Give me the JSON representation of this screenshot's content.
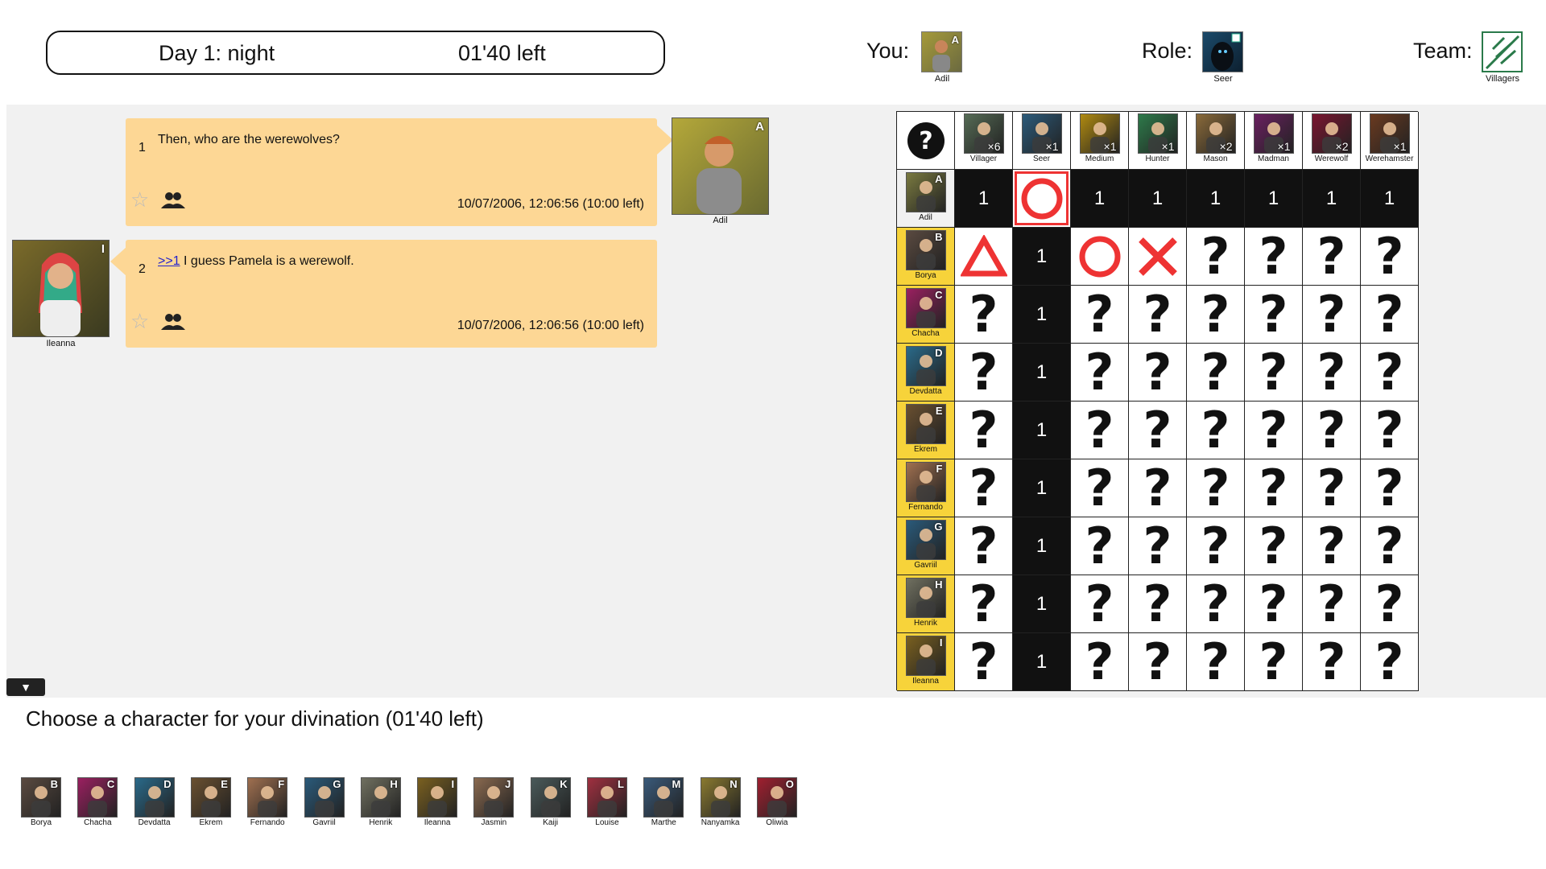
{
  "header": {
    "phase": "Day 1: night",
    "timer": "01'40 left",
    "you_label": "You:",
    "you_name": "Adil",
    "you_letter": "A",
    "role_label": "Role:",
    "role_name": "Seer",
    "team_label": "Team:",
    "team_name": "Villagers"
  },
  "messages": [
    {
      "num": "1",
      "text": "Then, who are the werewolves?",
      "timestamp": "10/07/2006, 12:06:56 (10:00 left)",
      "author": "Adil",
      "letter": "A"
    },
    {
      "num": "2",
      "reply": ">>1",
      "text": " I guess Pamela is a werewolf.",
      "timestamp": "10/07/2006, 12:06:56 (10:00 left)",
      "author": "Ileanna",
      "letter": "I"
    }
  ],
  "grid": {
    "unknown_icon": "question-circle-icon",
    "roles": [
      {
        "name": "Villager",
        "count": "×6",
        "color": "#556b55"
      },
      {
        "name": "Seer",
        "count": "×1",
        "color": "#2b5a7a"
      },
      {
        "name": "Medium",
        "count": "×1",
        "color": "#b08a10"
      },
      {
        "name": "Hunter",
        "count": "×1",
        "color": "#2d7a4a"
      },
      {
        "name": "Mason",
        "count": "×2",
        "color": "#8a6a3a"
      },
      {
        "name": "Madman",
        "count": "×1",
        "color": "#6a2060"
      },
      {
        "name": "Werewolf",
        "count": "×2",
        "color": "#7a1530"
      },
      {
        "name": "Werehamster",
        "count": "×1",
        "color": "#6a3a20"
      }
    ],
    "players": [
      {
        "name": "Adil",
        "letter": "A",
        "color": "#7a7a40",
        "cells": [
          "1",
          "sel",
          "1",
          "1",
          "1",
          "1",
          "1",
          "1"
        ]
      },
      {
        "name": "Borya",
        "letter": "B",
        "color": "#5a4a40",
        "cells": [
          "tri",
          "1",
          "circle",
          "cross",
          "?",
          "?",
          "?",
          "?"
        ]
      },
      {
        "name": "Chacha",
        "letter": "C",
        "color": "#9a2060",
        "cells": [
          "?",
          "1",
          "?",
          "?",
          "?",
          "?",
          "?",
          "?"
        ]
      },
      {
        "name": "Devdatta",
        "letter": "D",
        "color": "#2a6a8a",
        "cells": [
          "?",
          "1",
          "?",
          "?",
          "?",
          "?",
          "?",
          "?"
        ]
      },
      {
        "name": "Ekrem",
        "letter": "E",
        "color": "#6a5030",
        "cells": [
          "?",
          "1",
          "?",
          "?",
          "?",
          "?",
          "?",
          "?"
        ]
      },
      {
        "name": "Fernando",
        "letter": "F",
        "color": "#a07050",
        "cells": [
          "?",
          "1",
          "?",
          "?",
          "?",
          "?",
          "?",
          "?"
        ]
      },
      {
        "name": "Gavriil",
        "letter": "G",
        "color": "#2a5a7a",
        "cells": [
          "?",
          "1",
          "?",
          "?",
          "?",
          "?",
          "?",
          "?"
        ]
      },
      {
        "name": "Henrik",
        "letter": "H",
        "color": "#707060",
        "cells": [
          "?",
          "1",
          "?",
          "?",
          "?",
          "?",
          "?",
          "?"
        ]
      },
      {
        "name": "Ileanna",
        "letter": "I",
        "color": "#7a6020",
        "cells": [
          "?",
          "1",
          "?",
          "?",
          "?",
          "?",
          "?",
          "?"
        ]
      }
    ]
  },
  "choose": {
    "title": "Choose a character for your divination (01'40 left)",
    "collapse_icon": "chevron-down-icon",
    "characters": [
      {
        "name": "Borya",
        "letter": "B",
        "color": "#5a4a40"
      },
      {
        "name": "Chacha",
        "letter": "C",
        "color": "#9a2060"
      },
      {
        "name": "Devdatta",
        "letter": "D",
        "color": "#2a6a8a"
      },
      {
        "name": "Ekrem",
        "letter": "E",
        "color": "#6a5030"
      },
      {
        "name": "Fernando",
        "letter": "F",
        "color": "#a07050"
      },
      {
        "name": "Gavriil",
        "letter": "G",
        "color": "#2a5a7a"
      },
      {
        "name": "Henrik",
        "letter": "H",
        "color": "#707060"
      },
      {
        "name": "Ileanna",
        "letter": "I",
        "color": "#7a6020"
      },
      {
        "name": "Jasmin",
        "letter": "J",
        "color": "#8a6a50"
      },
      {
        "name": "Kaiji",
        "letter": "K",
        "color": "#4a5a5a"
      },
      {
        "name": "Louise",
        "letter": "L",
        "color": "#a03040"
      },
      {
        "name": "Marthe",
        "letter": "M",
        "color": "#3a5a7a"
      },
      {
        "name": "Nanyamka",
        "letter": "N",
        "color": "#8a7a30"
      },
      {
        "name": "Oliwia",
        "letter": "O",
        "color": "#a02030"
      }
    ]
  }
}
